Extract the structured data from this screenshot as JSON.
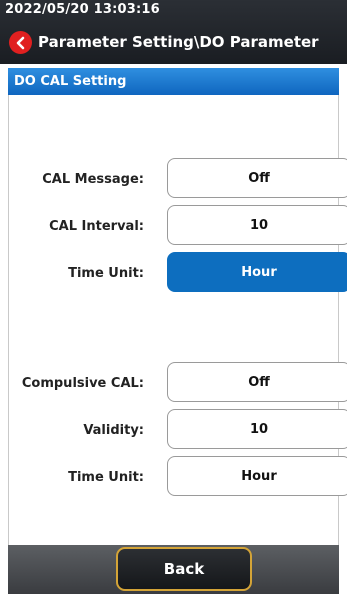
{
  "status": {
    "timestamp": "2022/05/20 13:03:16"
  },
  "header": {
    "title": "Parameter Setting\\DO Parameter"
  },
  "section": {
    "title": "DO CAL Setting"
  },
  "rows": [
    {
      "label": "CAL Message:",
      "value": "Off",
      "selected": false
    },
    {
      "label": "CAL Interval:",
      "value": "10",
      "selected": false
    },
    {
      "label": "Time Unit:",
      "value": "Hour",
      "selected": true
    },
    {
      "label": "Compulsive CAL:",
      "value": "Off",
      "selected": false
    },
    {
      "label": "Validity:",
      "value": "10",
      "selected": false
    },
    {
      "label": "Time Unit:",
      "value": "Hour",
      "selected": false
    }
  ],
  "footer": {
    "back_label": "Back"
  },
  "colors": {
    "accent": "#0d6ebf",
    "back_icon": "#e02020",
    "button_border": "#d4a437"
  }
}
